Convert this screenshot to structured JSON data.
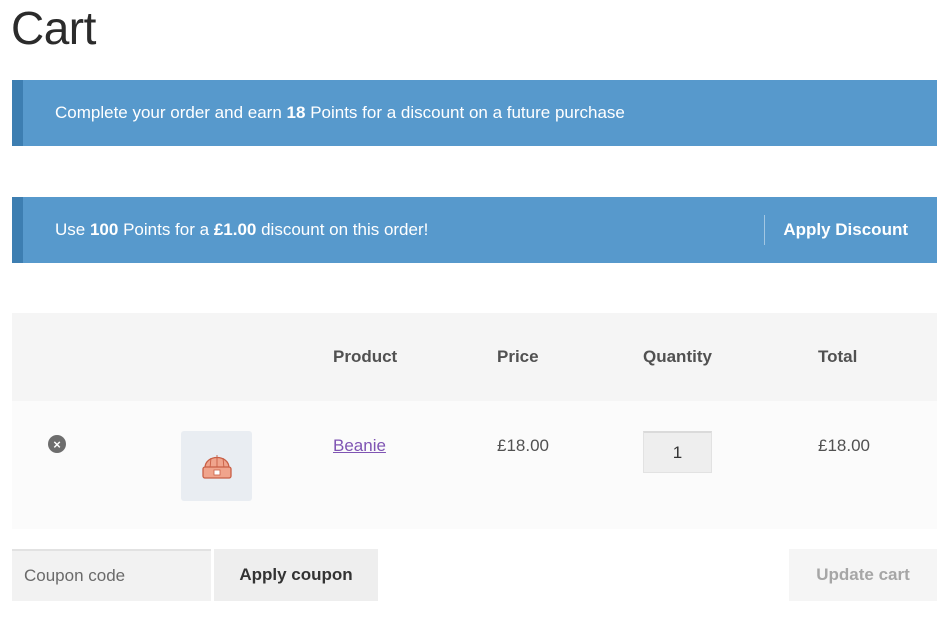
{
  "page": {
    "title": "Cart"
  },
  "notices": {
    "earn": {
      "prefix": "Complete your order and earn",
      "points": "18",
      "suffix": "Points for a discount on a future purchase"
    },
    "redeem": {
      "prefix": "Use",
      "points": "100",
      "mid": "Points for a",
      "amount": "£1.00",
      "suffix": "discount on this order!",
      "button_label": "Apply Discount"
    }
  },
  "cart": {
    "headers": [
      "Product",
      "Price",
      "Quantity",
      "Total"
    ],
    "items": [
      {
        "name": "Beanie",
        "price": "£18.00",
        "quantity": "1",
        "total": "£18.00",
        "thumbnail_icon": "beanie-hat-icon",
        "remove_icon": "remove-icon"
      }
    ]
  },
  "actions": {
    "coupon_placeholder": "Coupon code",
    "apply_coupon_label": "Apply coupon",
    "update_cart_label": "Update cart"
  },
  "colors": {
    "notice_bg": "#5799cc",
    "notice_border": "#3d7eb1",
    "link": "#7f54b3"
  }
}
